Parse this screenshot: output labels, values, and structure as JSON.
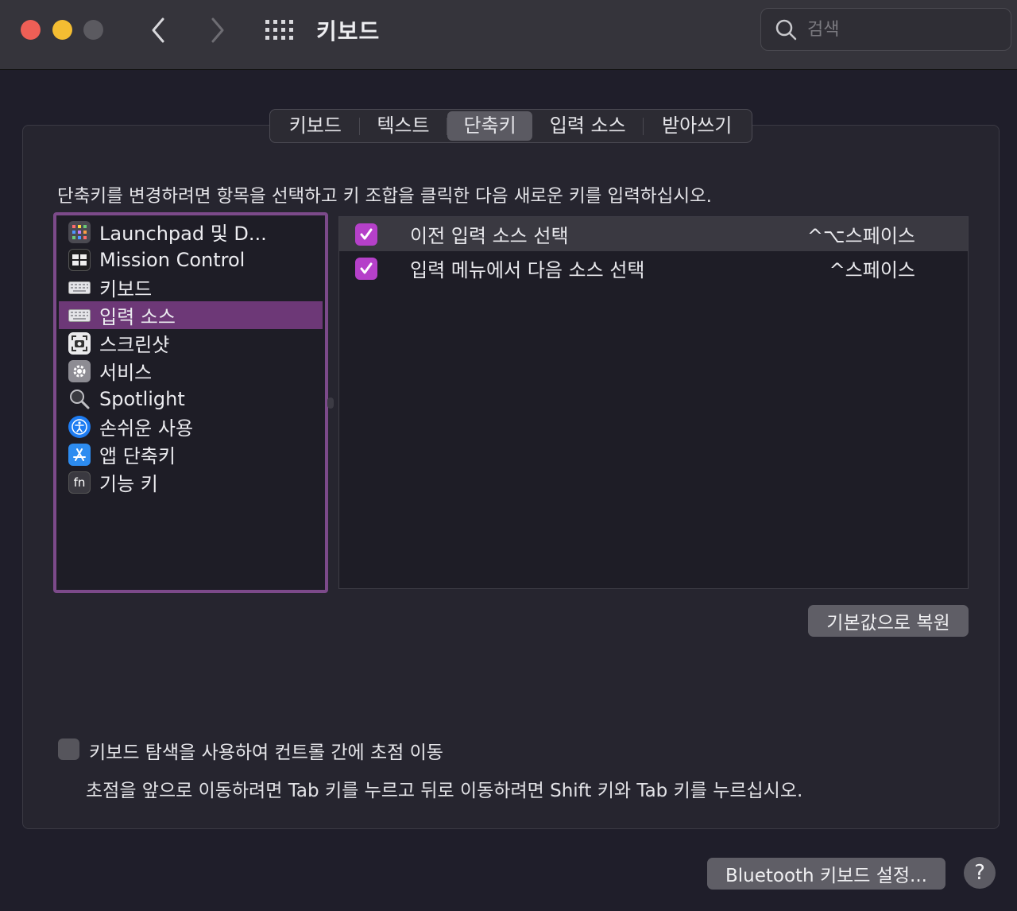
{
  "window": {
    "title": "키보드",
    "search_placeholder": "검색"
  },
  "tabs": [
    {
      "label": "키보드",
      "active": false
    },
    {
      "label": "텍스트",
      "active": false
    },
    {
      "label": "단축키",
      "active": true
    },
    {
      "label": "입력 소스",
      "active": false
    },
    {
      "label": "받아쓰기",
      "active": false
    }
  ],
  "instruction": "단축키를 변경하려면 항목을 선택하고 키 조합을 클릭한 다음 새로운 키를 입력하십시오.",
  "categories": [
    {
      "label": "Launchpad 및 D...",
      "icon": "launchpad-icon",
      "selected": false
    },
    {
      "label": "Mission Control",
      "icon": "mission-control-icon",
      "selected": false
    },
    {
      "label": "키보드",
      "icon": "keyboard-icon",
      "selected": false
    },
    {
      "label": "입력 소스",
      "icon": "keyboard-icon",
      "selected": true
    },
    {
      "label": "스크린샷",
      "icon": "screenshot-icon",
      "selected": false
    },
    {
      "label": "서비스",
      "icon": "gear-icon",
      "selected": false
    },
    {
      "label": "Spotlight",
      "icon": "magnifier-icon",
      "selected": false
    },
    {
      "label": "손쉬운 사용",
      "icon": "accessibility-icon",
      "selected": false
    },
    {
      "label": "앱 단축키",
      "icon": "app-store-icon",
      "selected": false
    },
    {
      "label": "기능 키",
      "icon": "fn-icon",
      "selected": false
    }
  ],
  "shortcuts": [
    {
      "label": "이전 입력 소스 선택",
      "keys": "^⌥스페이스",
      "checked": true
    },
    {
      "label": "입력 메뉴에서 다음 소스 선택",
      "keys": "^스페이스",
      "checked": true
    }
  ],
  "restore_label": "기본값으로 복원",
  "keyboard_nav": {
    "label": "키보드 탐색을 사용하여 컨트롤 간에 초점 이동",
    "checked": false,
    "help": "초점을 앞으로 이동하려면 Tab 키를 누르고 뒤로 이동하려면 Shift 키와 Tab 키를 누르십시오."
  },
  "bluetooth_label": "Bluetooth 키보드 설정...",
  "help_label": "?",
  "colors": {
    "accent": "#b540c9",
    "selection": "#6d3877",
    "focus_ring": "#7c4a8a"
  }
}
